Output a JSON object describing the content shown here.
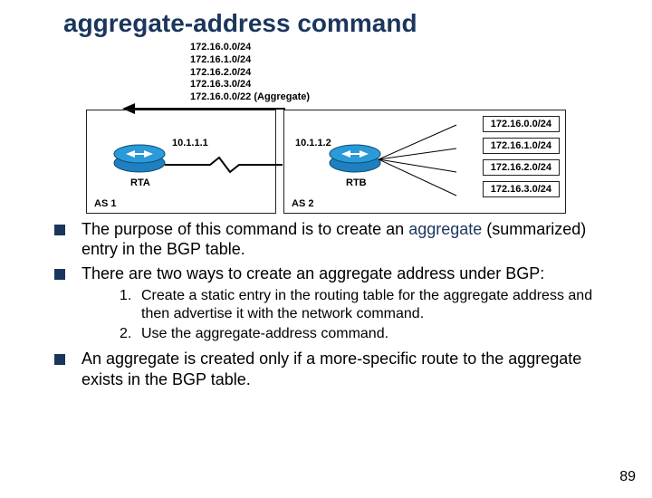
{
  "title": "aggregate-address command",
  "diagram": {
    "advertised_routes": [
      "172.16.0.0/24",
      "172.16.1.0/24",
      "172.16.2.0/24",
      "172.16.3.0/24",
      "172.16.0.0/22 (Aggregate)"
    ],
    "left": {
      "router": "RTA",
      "as": "AS 1",
      "if_ip": "10.1.1.1"
    },
    "right": {
      "router": "RTB",
      "as": "AS 2",
      "if_ip": "10.1.1.2",
      "routes": [
        "172.16.0.0/24",
        "172.16.1.0/24",
        "172.16.2.0/24",
        "172.16.3.0/24"
      ]
    }
  },
  "bullets": [
    {
      "pre": "The purpose of this command is to create an ",
      "accent": "aggregate",
      "post": " (summarized) entry in the BGP table."
    },
    {
      "pre": "There are two ways to create an aggregate address under BGP:",
      "accent": "",
      "post": ""
    }
  ],
  "numbered": [
    "Create a static entry in the routing table for the aggregate address and then advertise it with the network command.",
    "Use the aggregate-address command."
  ],
  "bullet_after": "An aggregate is created only if a more-specific route to the aggregate exists in the BGP table.",
  "page_number": "89"
}
